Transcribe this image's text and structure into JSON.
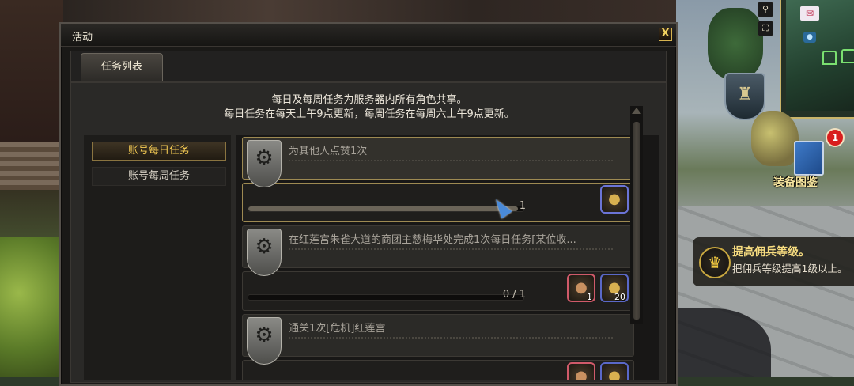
{
  "window": {
    "title": "活动",
    "close_label": "X",
    "tabs": [
      {
        "label": "任务列表"
      }
    ],
    "notice": [
      "每日及每周任务为服务器内所有角色共享。",
      "每日任务在每天上午9点更新，每周任务在每周六上午9点更新。"
    ],
    "categories": [
      {
        "label": "账号每日任务",
        "active": true
      },
      {
        "label": "账号每周任务",
        "active": false
      }
    ],
    "quests": [
      {
        "title": "为其他人点赞1次",
        "progress_text": "1",
        "progress": 0.98,
        "selected": true,
        "rewards": [
          {
            "icon": "gold-pouch-icon",
            "count": ""
          }
        ]
      },
      {
        "title": "在红莲宫朱雀大道的商团主慈梅华处完成1次每日任务[某位收...",
        "progress_text": "0 / 1",
        "progress": 0,
        "selected": false,
        "rewards": [
          {
            "icon": "stamina-bag-icon",
            "count": "1"
          },
          {
            "icon": "gold-pouch-icon",
            "count": "20"
          }
        ]
      },
      {
        "title": "通关1次[危机]红莲宫",
        "progress_text": "",
        "progress": 0,
        "selected": false,
        "rewards": [
          {
            "icon": "stamina-bag-icon",
            "count": ""
          },
          {
            "icon": "gold-pouch-icon",
            "count": ""
          }
        ]
      }
    ]
  },
  "hud": {
    "notification_badge": "1",
    "equipment_book_label": "装备图鉴",
    "mercenary_notice": {
      "title": "提高佣兵等级。",
      "description": "把佣兵等级提高1级以上。"
    },
    "minimap_buttons": [
      {
        "icon": "zoom-icon",
        "glyph": "⚲"
      },
      {
        "icon": "fullscreen-icon",
        "glyph": "⛶"
      }
    ]
  },
  "colors": {
    "accent_gold": "#f6cc54",
    "selected_border": "#9e8a52",
    "badge_red": "#d81e1e"
  }
}
